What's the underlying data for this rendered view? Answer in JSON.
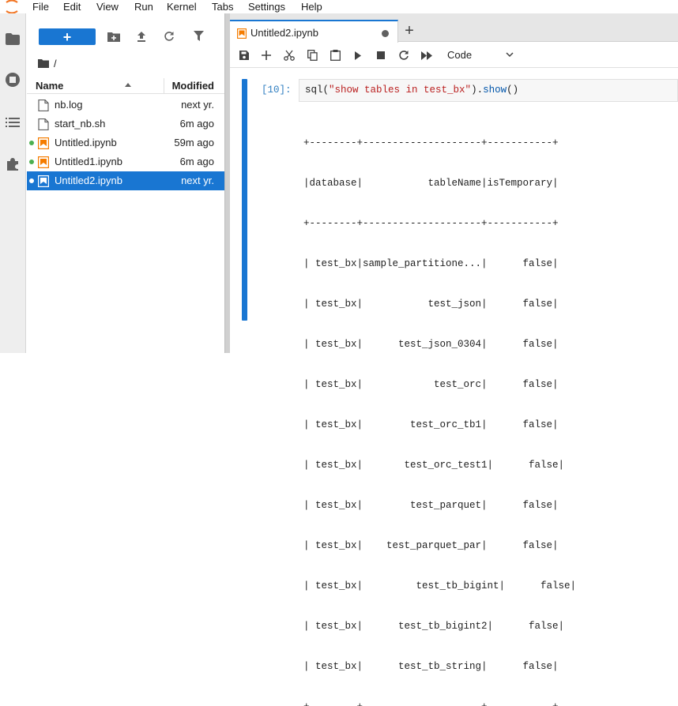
{
  "menubar": {
    "items": [
      "File",
      "Edit",
      "View",
      "Run",
      "Kernel",
      "Tabs",
      "Settings",
      "Help"
    ]
  },
  "activity_bar": {
    "icons": [
      "folder-icon",
      "running-icon",
      "toc-icon",
      "extension-icon"
    ]
  },
  "file_browser": {
    "new_button_label": "+",
    "breadcrumb": "/",
    "columns": {
      "name": "Name",
      "modified": "Modified"
    },
    "files": [
      {
        "name": "nb.log",
        "modified": "next yr.",
        "type": "file",
        "running": false,
        "selected": false
      },
      {
        "name": "start_nb.sh",
        "modified": "6m ago",
        "type": "file",
        "running": false,
        "selected": false
      },
      {
        "name": "Untitled.ipynb",
        "modified": "59m ago",
        "type": "notebook",
        "running": true,
        "selected": false
      },
      {
        "name": "Untitled1.ipynb",
        "modified": "6m ago",
        "type": "notebook",
        "running": true,
        "selected": false
      },
      {
        "name": "Untitled2.ipynb",
        "modified": "next yr.",
        "type": "notebook",
        "running": true,
        "selected": true
      }
    ]
  },
  "notebook": {
    "tab_label": "Untitled2.ipynb",
    "add_tab": "+",
    "cell_type": "Code",
    "cell": {
      "prompt": "[10]:",
      "code": {
        "fn": "sql",
        "open": "(",
        "str": "\"show tables in test_bx\"",
        "close": ").",
        "method": "show",
        "end": "()"
      },
      "output_lines": [
        "+--------+--------------------+-----------+",
        "|database|           tableName|isTemporary|",
        "+--------+--------------------+-----------+",
        "| test_bx|sample_partitione...|      false|",
        "| test_bx|           test_json|      false|",
        "| test_bx|      test_json_0304|      false|",
        "| test_bx|            test_orc|      false|",
        "| test_bx|        test_orc_tb1|      false|",
        "| test_bx|       test_orc_test1|      false|",
        "| test_bx|        test_parquet|      false|",
        "| test_bx|    test_parquet_par|      false|",
        "| test_bx|         test_tb_bigint|      false|",
        "| test_bx|      test_tb_bigint2|      false|",
        "| test_bx|      test_tb_string|      false|",
        "+--------+--------------------+-----------+"
      ]
    }
  },
  "colors": {
    "accent": "#1976d2",
    "running_dot": "#4caf50",
    "notebook_icon": "#f57c00",
    "string": "#ba2121",
    "prompt": "#307fc1"
  }
}
